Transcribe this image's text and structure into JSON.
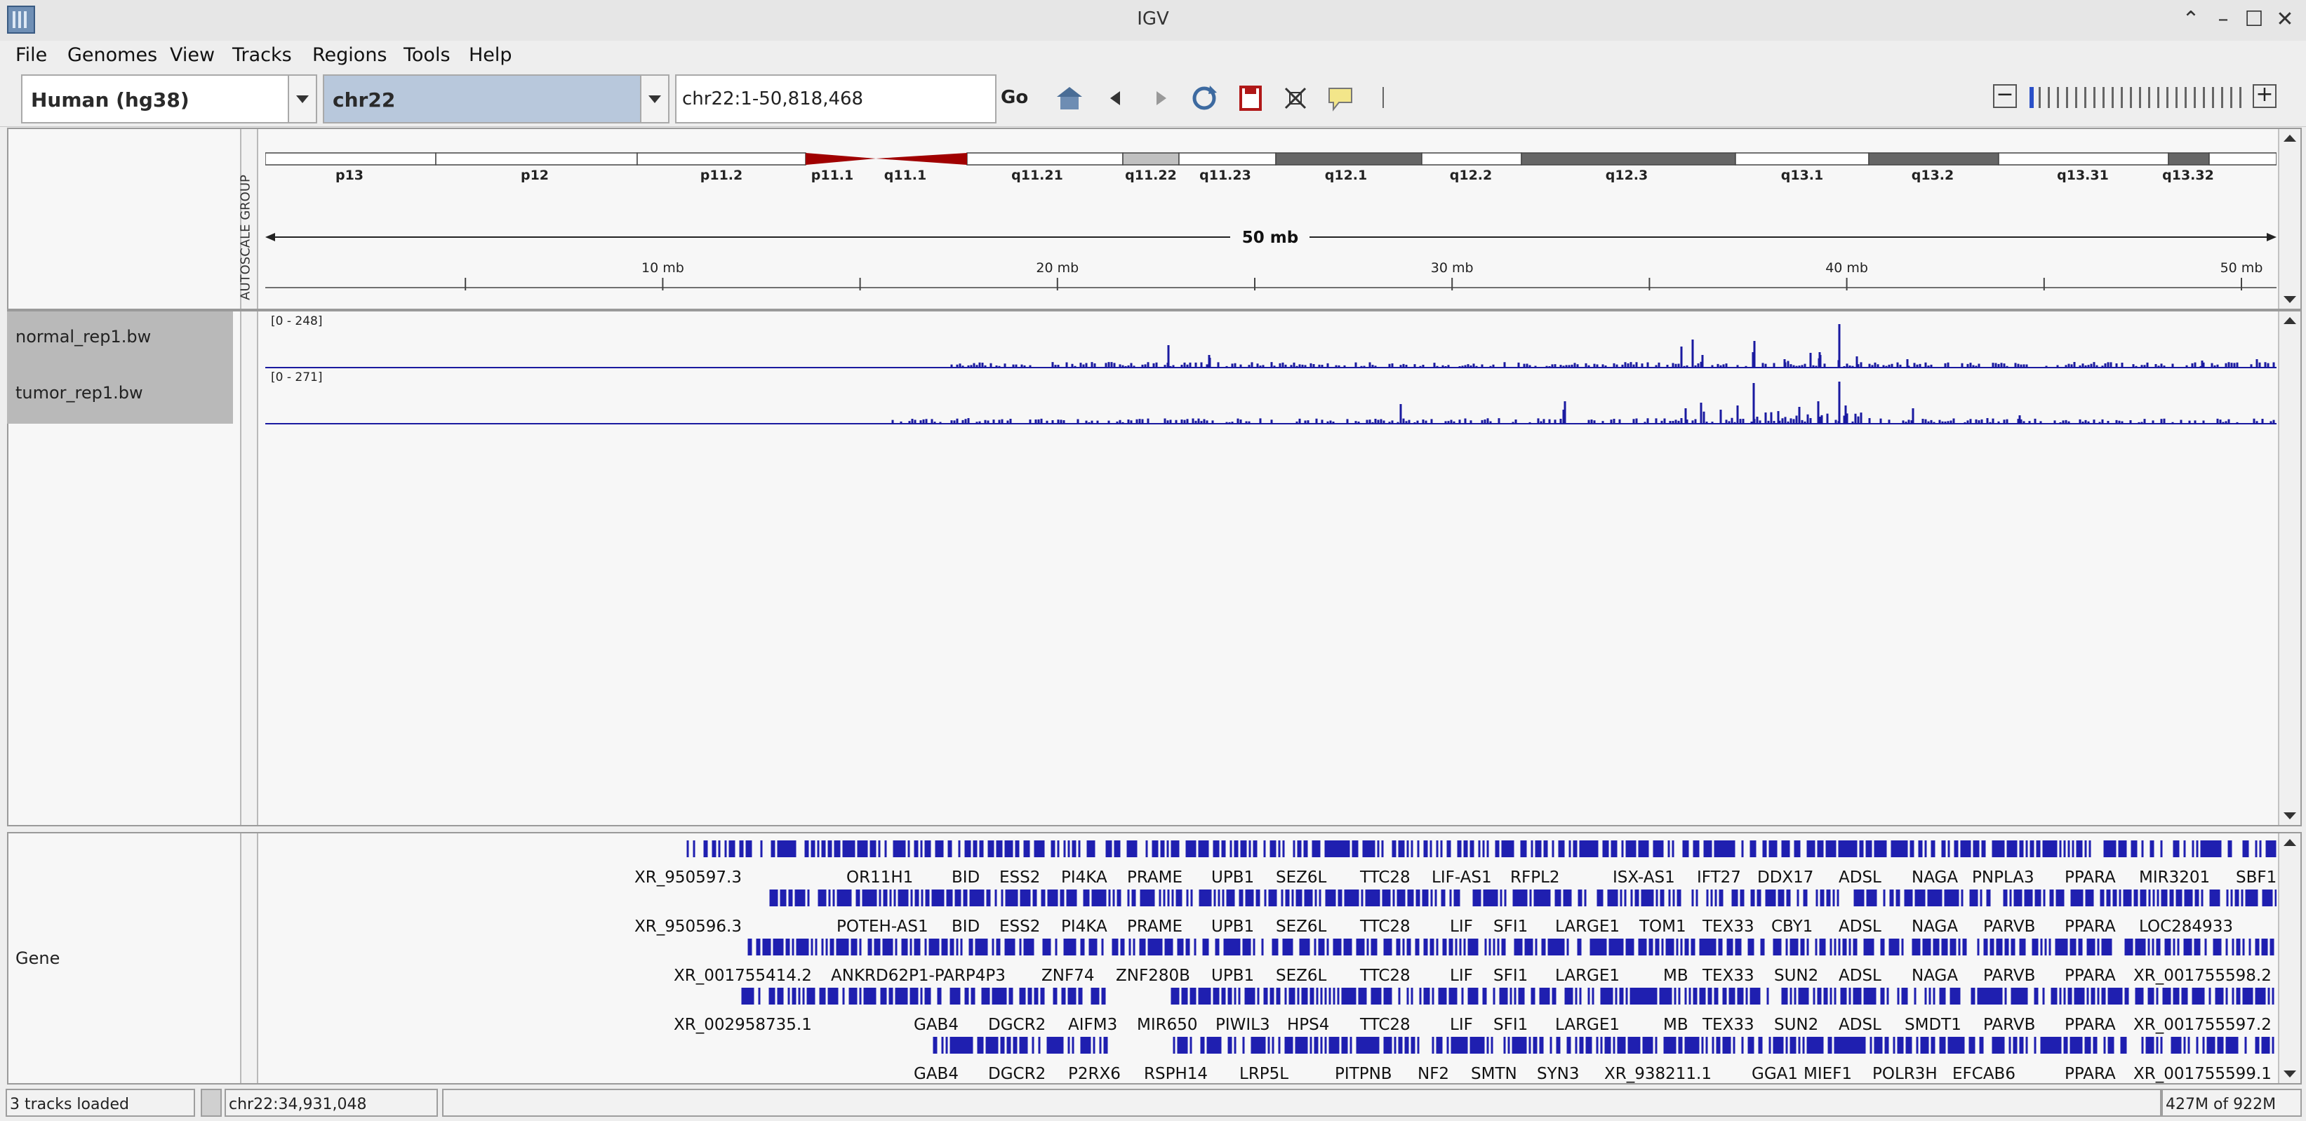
{
  "window": {
    "title": "IGV"
  },
  "menu": [
    "File",
    "Genomes",
    "View",
    "Tracks",
    "Regions",
    "Tools",
    "Help"
  ],
  "toolbar": {
    "genome": "Human (hg38)",
    "chromosome": "chr22",
    "locus": "chr22:1-50,818,468",
    "go_label": "Go"
  },
  "ideogram": {
    "bands": [
      "p13",
      "p12",
      "p11.2",
      "p11.1",
      "q11.1",
      "q11.21",
      "q11.22",
      "q11.23",
      "q12.1",
      "q12.2",
      "q12.3",
      "q13.1",
      "q13.2",
      "q13.31",
      "q13.32"
    ],
    "span_label": "50 mb",
    "ruler_ticks": [
      "10 mb",
      "20 mb",
      "30 mb",
      "40 mb",
      "50 mb"
    ],
    "autoscale_label": "AUTOSCALE GROUP"
  },
  "tracks": [
    {
      "name": "normal_rep1.bw",
      "range": "[0 - 248]"
    },
    {
      "name": "tumor_rep1.bw",
      "range": "[0 - 271]"
    }
  ],
  "gene_track": {
    "name": "Gene",
    "rows": [
      [
        "XR_950597.3",
        "OR11H1",
        "BID",
        "ESS2",
        "PI4KA",
        "PRAME",
        "UPB1",
        "SEZ6L",
        "TTC28",
        "LIF-AS1",
        "RFPL2",
        "ISX-AS1",
        "IFT27",
        "DDX17",
        "ADSL",
        "NAGA",
        "PNPLA3",
        "PPARA",
        "MIR3201",
        "SBF1"
      ],
      [
        "XR_950596.3",
        "POTEH-AS1",
        "BID",
        "ESS2",
        "PI4KA",
        "PRAME",
        "UPB1",
        "SEZ6L",
        "TTC28",
        "LIF",
        "SFI1",
        "LARGE1",
        "TOM1",
        "TEX33",
        "CBY1",
        "ADSL",
        "NAGA",
        "PARVB",
        "PPARA",
        "LOC284933"
      ],
      [
        "XR_001755414.2",
        "ANKRD62P1-PARP4P3",
        "ZNF74",
        "ZNF280B",
        "UPB1",
        "SEZ6L",
        "TTC28",
        "LIF",
        "SFI1",
        "LARGE1",
        "MB",
        "TEX33",
        "SUN2",
        "ADSL",
        "NAGA",
        "PARVB",
        "PPARA",
        "XR_001755598.2"
      ],
      [
        "XR_002958735.1",
        "GAB4",
        "DGCR2",
        "AIFM3",
        "MIR650",
        "PIWIL3",
        "HPS4",
        "TTC28",
        "LIF",
        "SFI1",
        "LARGE1",
        "MB",
        "TEX33",
        "SUN2",
        "ADSL",
        "SMDT1",
        "PARVB",
        "PPARA",
        "XR_001755597.2"
      ],
      [
        "GAB4",
        "DGCR2",
        "P2RX6",
        "RSPH14",
        "LRP5L",
        "PITPNB",
        "NF2",
        "SMTN",
        "SYN3",
        "XR_938211.1",
        "GGA1",
        "MIEF1",
        "POLR3H",
        "EFCAB6",
        "PPARA",
        "XR_001755599.1"
      ]
    ]
  },
  "status": {
    "tracks_loaded": "3 tracks loaded",
    "position": "chr22:34,931,048",
    "memory": "427M of 922M"
  }
}
